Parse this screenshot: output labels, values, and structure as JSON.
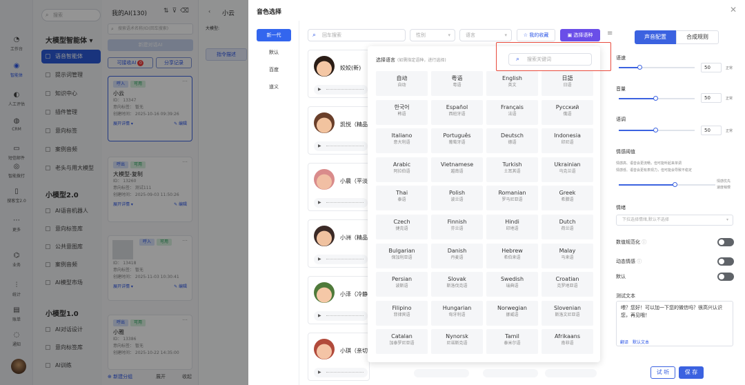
{
  "rail": {
    "items": [
      {
        "icon": "workbench-icon",
        "label": "工作台"
      },
      {
        "icon": "agent-icon",
        "label": "智能体"
      },
      {
        "icon": "review-icon",
        "label": "人工评估"
      },
      {
        "icon": "crm-icon",
        "label": "CRM"
      },
      {
        "icon": "sms-icon",
        "label": "短信邮件"
      },
      {
        "icon": "ai-call-icon",
        "label": "智能拨打"
      },
      {
        "icon": "search-treasure-icon",
        "label": "搜客宝2.0"
      },
      {
        "icon": "more-icon",
        "label": "更多"
      },
      {
        "icon": "qa-icon",
        "label": "业务"
      },
      {
        "icon": "stats-icon",
        "label": "统计"
      },
      {
        "icon": "bill-icon",
        "label": "账单"
      },
      {
        "icon": "notify-icon",
        "label": "通知"
      }
    ]
  },
  "nav": {
    "search_placeholder": "搜索",
    "group_large": "大模型智能体",
    "group_large_arrow": "▾",
    "items_large": [
      "语音智能体",
      "提示词管理",
      "知识中心",
      "插件管理",
      "意向标签",
      "案例音频",
      "老头与用大模型"
    ],
    "group_small2": "小模型2.0",
    "items_small2": [
      "AI语音机器人",
      "意向标签库",
      "公共意图库",
      "案例音频",
      "AI模型市场"
    ],
    "group_small1": "小模型1.0",
    "items_small1": [
      "AI对话设计",
      "意向标签库",
      "AI训练"
    ]
  },
  "agents": {
    "title": "我的AI(130)",
    "search_placeholder": "搜索语术名称/ID(回车搜索)",
    "new_button": "新建对话AI",
    "receive_button": "可接收AI",
    "receive_badge": "0",
    "share_button": "分享记录",
    "cards": [
      {
        "tags": [
          "呼入",
          "可用"
        ],
        "name": "小云",
        "id": "ID： 13347",
        "intent": "意向标签： 暂无",
        "created": "创建时间： 2025-10-16 09:39:26",
        "detail": "展开详情 ▾",
        "edit": "✎ 编辑"
      },
      {
        "tags": [
          "呼出",
          "可用"
        ],
        "name": "大模型-复制",
        "id": "ID： 13260",
        "intent": "意向标签： 测试111",
        "created": "创建时间： 2025-09-03 11:50:26",
        "detail": "展开详情 ▾",
        "edit": "✎ 编辑"
      },
      {
        "tags": [
          "呼入",
          "可用"
        ],
        "name": "",
        "id": "ID： 13418",
        "intent": "意向标签： 暂无",
        "created": "创建时间： 2025-11-03 10:30:41",
        "detail": "展开详情 ▾",
        "edit": "✎ 编辑"
      },
      {
        "tags": [
          "呼出",
          "可用"
        ],
        "name": "小雅",
        "id": "ID： 13386",
        "intent": "意向标签： 暂无",
        "created": "创建时间： 2025-10-22 14:35:00",
        "detail": "",
        "edit": ""
      }
    ],
    "bottom_add": "⊕ 新建分组",
    "bottom_expand": "展开",
    "bottom_collapse": "收起"
  },
  "bg": {
    "back": "‹",
    "title": "小云",
    "model": "大模型:",
    "prompt_tab": "指令描述"
  },
  "modal": {
    "title": "音色选择",
    "close": "✕",
    "categories": [
      "新一代",
      "默认",
      "百度",
      "道义"
    ],
    "voice_search_placeholder": "回车搜索",
    "gender_placeholder": "性别",
    "language_placeholder": "语言",
    "fav_button": "☆ 我的收藏",
    "lang_button": "选择语种",
    "voices": [
      {
        "name": "姣姣(新)",
        "play": "▶",
        "color": "#f4c7a5",
        "hair": "#2b1d16"
      },
      {
        "name": "凯悦（精品",
        "play": "▶",
        "color": "#f2c39f",
        "hair": "#6a3f2a"
      },
      {
        "name": "小晨（平淡",
        "play": "▶",
        "color": "#f1bfa4",
        "hair": "#d98b8b"
      },
      {
        "name": "小洲（精品",
        "play": "▶",
        "color": "#f0c2a0",
        "hair": "#3b2a26"
      },
      {
        "name": "小泽（冷静",
        "play": "▶",
        "color": "#f5c8a7",
        "hair": "#4f7a3a"
      },
      {
        "name": "小琪（亲切",
        "play": "▶",
        "color": "#f4c4a6",
        "hair": "#b14a3b"
      }
    ]
  },
  "lang_panel": {
    "title": "选择语言",
    "subtitle": "(如需指定语种，进行选择)",
    "keyword_placeholder": "搜索关键词",
    "langs": [
      [
        "自动",
        "自动"
      ],
      [
        "粤语",
        "粤语"
      ],
      [
        "English",
        "英文"
      ],
      [
        "日語",
        "日语"
      ],
      [
        "한국어",
        "韩语"
      ],
      [
        "Español",
        "西班牙语"
      ],
      [
        "Français",
        "法语"
      ],
      [
        "Русский",
        "俄语"
      ],
      [
        "Italiano",
        "意大利语"
      ],
      [
        "Português",
        "葡萄牙语"
      ],
      [
        "Deutsch",
        "德语"
      ],
      [
        "Indonesia",
        "印尼语"
      ],
      [
        "Arabic",
        "阿拉伯语"
      ],
      [
        "Vietnamese",
        "越南语"
      ],
      [
        "Turkish",
        "土耳其语"
      ],
      [
        "Ukrainian",
        "乌克兰语"
      ],
      [
        "Thai",
        "泰语"
      ],
      [
        "Polish",
        "波兰语"
      ],
      [
        "Romanian",
        "罗马尼亚语"
      ],
      [
        "Greek",
        "希腊语"
      ],
      [
        "Czech",
        "捷克语"
      ],
      [
        "Finnish",
        "芬兰语"
      ],
      [
        "Hindi",
        "印地语"
      ],
      [
        "Dutch",
        "荷兰语"
      ],
      [
        "Bulgarian",
        "保加利亚语"
      ],
      [
        "Danish",
        "丹麦语"
      ],
      [
        "Hebrew",
        "希伯来语"
      ],
      [
        "Malay",
        "马来语"
      ],
      [
        "Persian",
        "波斯语"
      ],
      [
        "Slovak",
        "斯洛伐克语"
      ],
      [
        "Swedish",
        "瑞典语"
      ],
      [
        "Croatian",
        "克罗地亚语"
      ],
      [
        "Filipino",
        "菲律宾语"
      ],
      [
        "Hungarian",
        "匈牙利语"
      ],
      [
        "Norwegian",
        "挪威语"
      ],
      [
        "Slovenian",
        "斯洛文尼亚语"
      ],
      [
        "Catalan",
        "加泰罗尼亚语"
      ],
      [
        "Nynorsk",
        "尼诺斯克语"
      ],
      [
        "Tamil",
        "泰米尔语"
      ],
      [
        "Afrikaans",
        "南非语"
      ]
    ]
  },
  "config": {
    "tab_voice": "声音配置",
    "tab_rules": "合成规则",
    "speed_label": "语速",
    "speed_value": "50",
    "speed_level": 0.27,
    "volume_label": "音量",
    "volume_value": "50",
    "volume_level": 0.48,
    "pitch_label": "语调",
    "pitch_value": "50",
    "pitch_level": 0.48,
    "unit": "正常",
    "emotion_threshold_label": "情感阈值",
    "emotion_hint1": "情感高、语音会更流畅，但可能听起来单调",
    "emotion_hint2": "情感低、语音会更有表现力，但可能会导致不稳定",
    "emotion_right1": "情感优先",
    "emotion_right2": "速度稍慢",
    "emotion_level": 0.58,
    "emotion_label": "情绪",
    "emotion_placeholder": "下拉选择情绪,默认不选择",
    "normalize_label": "数值规范化",
    "dynamic_label": "动态情感",
    "default_label": "默认",
    "test_text_label": "测试文本",
    "test_text": "喂？您好！可以加一下您的微信吗？很高兴认识您，再见哦！",
    "link_translate": "翻译",
    "link_default": "默认文本",
    "try_button": "试 听",
    "save_button": "保 存"
  }
}
